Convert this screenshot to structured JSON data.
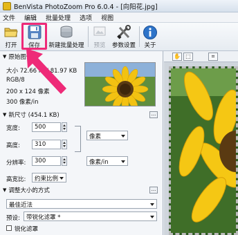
{
  "window": {
    "title": "BenVista PhotoZoom Pro 6.0.4 - [向阳花.jpg]"
  },
  "menu": [
    "文件",
    "编辑",
    "批量处理",
    "选项",
    "视图"
  ],
  "toolbar": {
    "open": "打开",
    "save": "保存",
    "batch": "新建批量处理",
    "preview": "预览",
    "settings": "参数设置",
    "about": "关于"
  },
  "original": {
    "header": "原始图像",
    "size": "大小 72.66 KB/ 81.97 KB",
    "mode": "RGB/8",
    "dimensions": "200 x 124 像素",
    "resolution": "300 像素/in"
  },
  "new_size": {
    "header": "新尺寸 (454.1 KB)",
    "width_label": "宽度:",
    "width_value": "500",
    "height_label": "高度:",
    "height_value": "310",
    "resolution_label": "分辨率:",
    "resolution_value": "300",
    "unit_select": "像素",
    "res_unit_select": "像素/in",
    "aspect_label": "高宽比:",
    "aspect_select": "约束比例"
  },
  "resize_method": {
    "header": "调整大小的方式",
    "method_select": "最佳近法",
    "preset_label": "预设:",
    "preset_select": "带锐化滤罩 *",
    "advanced_label": "锐化滤罩"
  },
  "icons": [
    "open-icon",
    "save-icon",
    "batch-icon",
    "preview-icon",
    "settings-icon",
    "about-icon",
    "hand-icon",
    "zoom-icon",
    "crop-icon"
  ]
}
